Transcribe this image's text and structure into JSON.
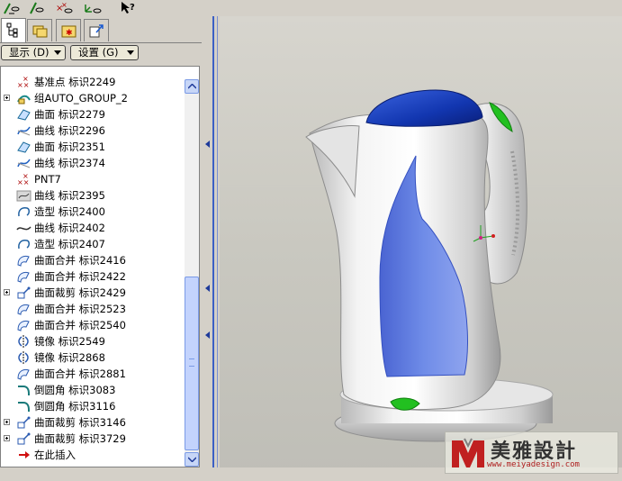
{
  "toolbar": {
    "icons": [
      "show-icon",
      "datum-display-icon",
      "point-display-icon",
      "coord-display-icon",
      "whats-this-help-icon"
    ]
  },
  "tabs": [
    {
      "name": "model-tree-tab",
      "icon": "tree-icon",
      "active": true
    },
    {
      "name": "folder-browser-tab",
      "icon": "folder-icon",
      "active": false
    },
    {
      "name": "favorites-tab",
      "icon": "favorites-icon",
      "active": false
    },
    {
      "name": "connections-tab",
      "icon": "connections-icon",
      "active": false
    }
  ],
  "buttons": {
    "display_label": "显示 (D)",
    "settings_label": "设置 (G)"
  },
  "tree": {
    "items": [
      {
        "label": "基准点 标识2249",
        "icon": "datum-point-icon",
        "expandable": false
      },
      {
        "label": "组AUTO_GROUP_2",
        "icon": "group-icon",
        "expandable": true
      },
      {
        "label": "曲面 标识2279",
        "icon": "surface-icon",
        "expandable": false
      },
      {
        "label": "曲线 标识2296",
        "icon": "curve-icon",
        "expandable": false
      },
      {
        "label": "曲面 标识2351",
        "icon": "surface-icon",
        "expandable": false
      },
      {
        "label": "曲线 标识2374",
        "icon": "curve-icon",
        "expandable": false
      },
      {
        "label": "PNT7",
        "icon": "datum-point-icon",
        "expandable": false
      },
      {
        "label": "曲线 标识2395",
        "icon": "sketched-curve-icon",
        "expandable": false
      },
      {
        "label": "造型 标识2400",
        "icon": "style-icon",
        "expandable": false
      },
      {
        "label": "曲线 标识2402",
        "icon": "curve-line-icon",
        "expandable": false
      },
      {
        "label": "造型 标识2407",
        "icon": "style-icon",
        "expandable": false
      },
      {
        "label": "曲面合并 标识2416",
        "icon": "merge-icon",
        "expandable": false
      },
      {
        "label": "曲面合并 标识2422",
        "icon": "merge-icon",
        "expandable": false
      },
      {
        "label": "曲面裁剪 标识2429",
        "icon": "trim-icon",
        "expandable": true
      },
      {
        "label": "曲面合并 标识2523",
        "icon": "merge-icon",
        "expandable": false
      },
      {
        "label": "曲面合并 标识2540",
        "icon": "merge-icon",
        "expandable": false
      },
      {
        "label": "镜像 标识2549",
        "icon": "mirror-icon",
        "expandable": false
      },
      {
        "label": "镜像 标识2868",
        "icon": "mirror-icon",
        "expandable": false
      },
      {
        "label": "曲面合并 标识2881",
        "icon": "merge-icon",
        "expandable": false
      },
      {
        "label": "倒圆角 标识3083",
        "icon": "round-icon",
        "expandable": false
      },
      {
        "label": "倒圆角 标识3116",
        "icon": "round-icon",
        "expandable": false
      },
      {
        "label": "曲面裁剪 标识3146",
        "icon": "trim-icon",
        "expandable": true
      },
      {
        "label": "曲面裁剪 标识3729",
        "icon": "trim-icon",
        "expandable": true
      },
      {
        "label": "在此插入",
        "icon": "insert-here-icon",
        "expandable": false
      }
    ]
  },
  "watermark": {
    "title": "美雅設計",
    "url": "www.meiyadesign.com"
  },
  "colors": {
    "lid_blue": "#1236b0",
    "window_blue": "#5a78de",
    "accent_green": "#22c020",
    "body_silver": "#e8e8e8"
  }
}
